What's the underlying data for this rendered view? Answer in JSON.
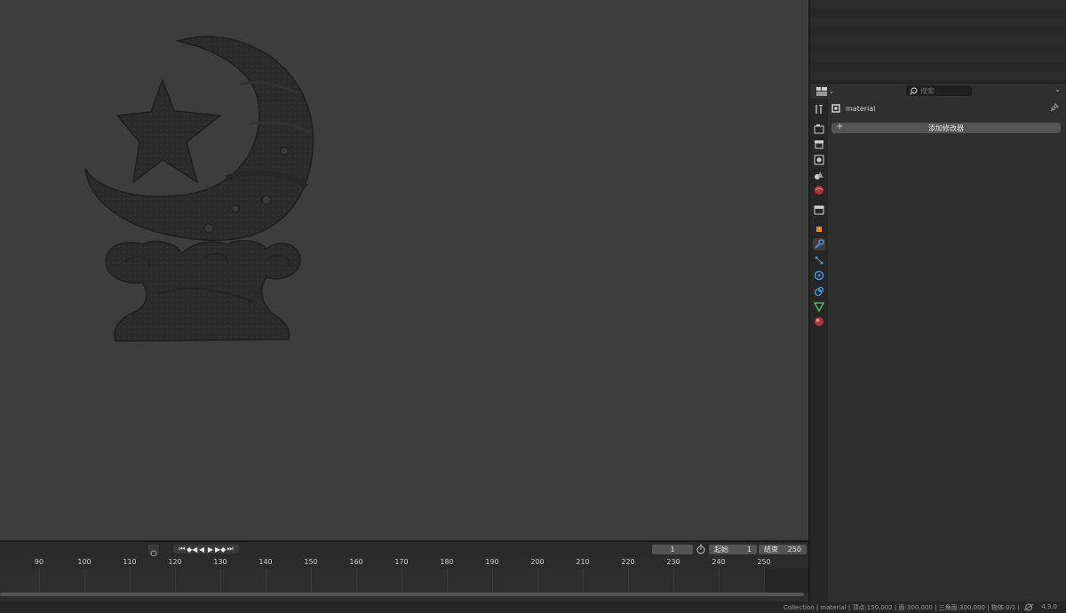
{
  "properties": {
    "search_placeholder": "搜索",
    "object_name": "material",
    "add_modifier_label": "添加修改器",
    "tabs": [
      "tool-icon",
      "render-icon",
      "output-icon",
      "view-layer-icon",
      "scene-icon",
      "world-icon",
      "collection-icon",
      "object-icon",
      "modifier-icon",
      "particles-icon",
      "physics-icon",
      "constraints-icon",
      "data-icon",
      "material-icon"
    ],
    "active_tab": "modifier-icon"
  },
  "timeline": {
    "current_frame": "1",
    "start_label": "起始",
    "start_value": "1",
    "end_label": "结束",
    "end_value": "250",
    "ruler_ticks": [
      "90",
      "100",
      "110",
      "120",
      "130",
      "140",
      "150",
      "160",
      "170",
      "180",
      "190",
      "200",
      "210",
      "220",
      "230",
      "240",
      "250"
    ]
  },
  "status_bar": {
    "text": "Collection | material | 顶点:150,002 | 面:300,000 | 三角面:300,000 | 物体:0/1 |",
    "version": "4.3.0"
  },
  "colors": {
    "viewport_bg": "#3d3d3d",
    "panel_bg": "#2f2f2f",
    "active_blue": "#4a90d9"
  }
}
